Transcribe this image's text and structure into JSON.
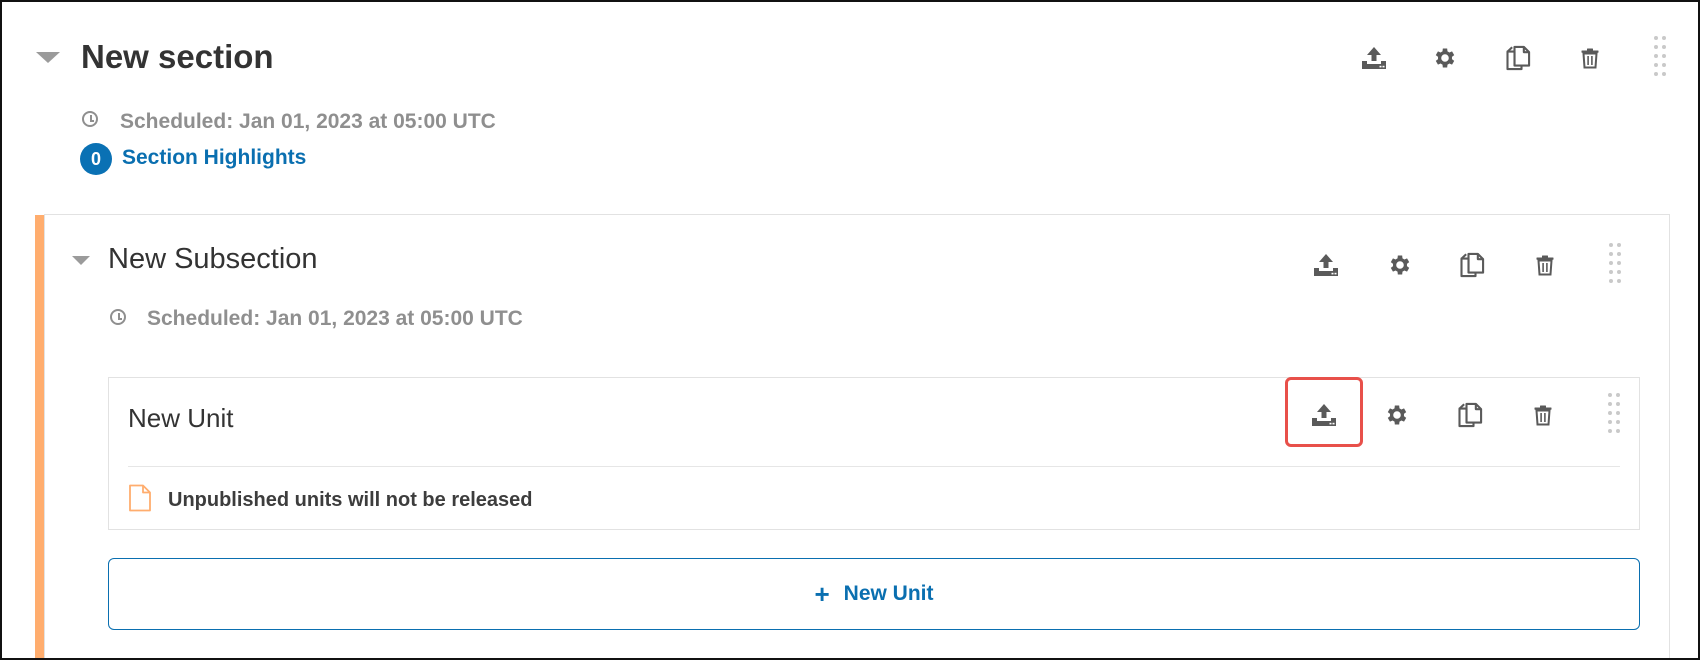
{
  "section": {
    "title": "New section",
    "scheduled": "Scheduled: Jan 01, 2023 at 05:00 UTC",
    "highlights_count": "0",
    "highlights_label": "Section Highlights"
  },
  "subsection": {
    "title": "New Subsection",
    "scheduled": "Scheduled: Jan 01, 2023 at 05:00 UTC"
  },
  "unit": {
    "title": "New Unit",
    "warning": "Unpublished units will not be released"
  },
  "new_unit_button": {
    "plus": "+",
    "label": "New Unit"
  },
  "icons": {
    "publish": "publish-icon",
    "settings": "gear-icon",
    "duplicate": "duplicate-icon",
    "delete": "trash-icon",
    "drag": "drag-handle-icon",
    "clock": "clock-icon",
    "document": "document-icon",
    "collapse": "caret-down-icon"
  },
  "colors": {
    "accent": "#0a6fb0",
    "subsection_bar": "#ffad6e",
    "highlight": "#e8504a",
    "muted_text": "#8f8f8f"
  }
}
